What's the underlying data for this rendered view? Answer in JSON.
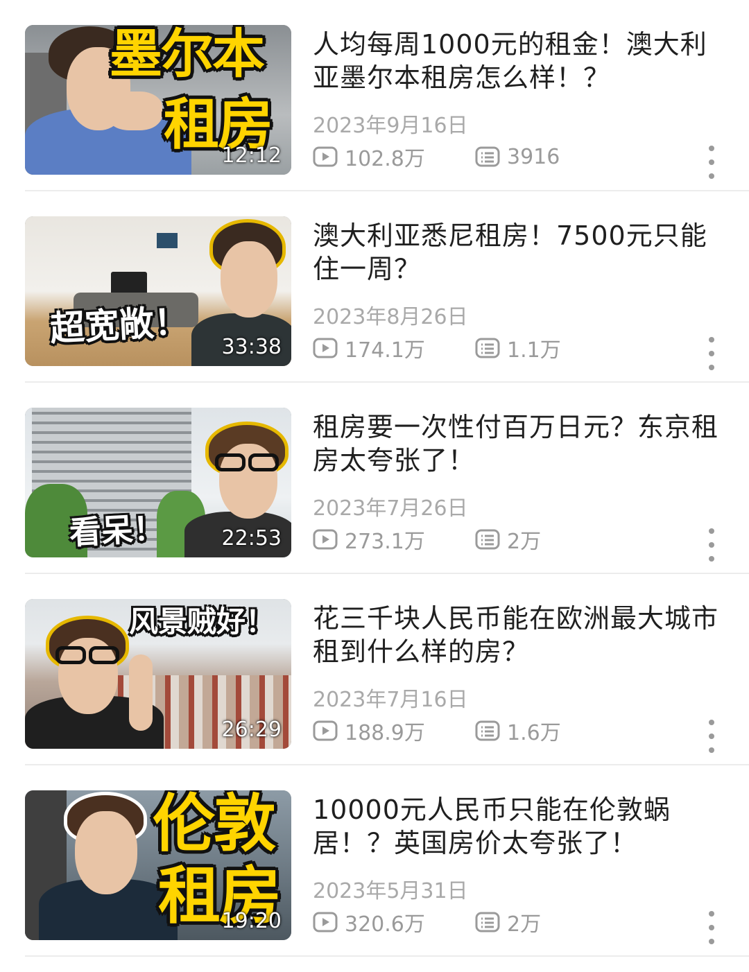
{
  "videos": [
    {
      "title": "人均每周1000元的租金！澳大利亚墨尔本租房怎么样！？",
      "date": "2023年9月16日",
      "views": "102.8万",
      "comments": "3916",
      "duration": "12:12",
      "thumb_text": [
        "墨尔本",
        "租房"
      ],
      "thumb_icon": "person-pointing"
    },
    {
      "title": "澳大利亚悉尼租房！7500元只能住一周？",
      "date": "2023年8月26日",
      "views": "174.1万",
      "comments": "1.1万",
      "duration": "33:38",
      "thumb_text": [
        "超宽敞！"
      ],
      "thumb_icon": "living-room"
    },
    {
      "title": "租房要一次性付百万日元？东京租房太夸张了！",
      "date": "2023年7月26日",
      "views": "273.1万",
      "comments": "2万",
      "duration": "22:53",
      "thumb_text": [
        "看呆！"
      ],
      "thumb_icon": "apartment-building"
    },
    {
      "title": "花三千块人民币能在欧洲最大城市租到什么样的房？",
      "date": "2023年7月16日",
      "views": "188.9万",
      "comments": "1.6万",
      "duration": "26:29",
      "thumb_text": [
        "风景贼好！"
      ],
      "thumb_icon": "city-view"
    },
    {
      "title": "10000元人民币只能在伦敦蜗居！？英国房价太夸张了！",
      "date": "2023年5月31日",
      "views": "320.6万",
      "comments": "2万",
      "duration": "19:20",
      "thumb_text": [
        "伦敦",
        "租房"
      ],
      "thumb_icon": "person-portrait"
    }
  ],
  "colors": {
    "overlay_yellow": "#ffd400",
    "meta_gray": "#a9a9a9",
    "title_text": "#1f1f1f"
  }
}
